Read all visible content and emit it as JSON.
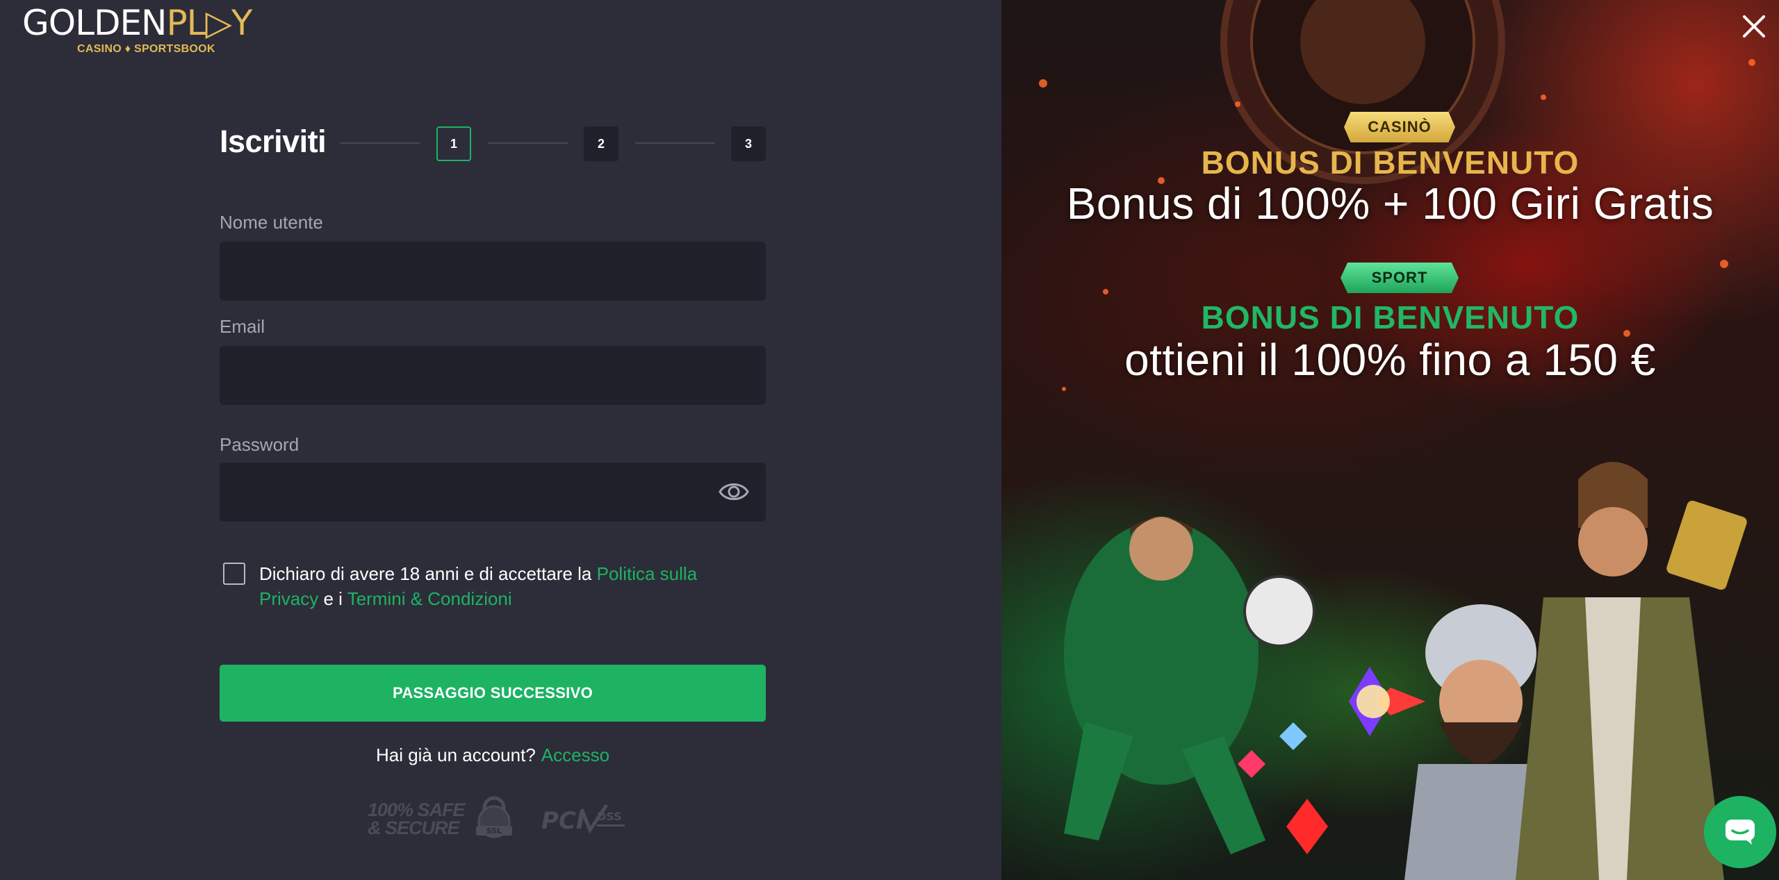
{
  "brand": {
    "logo_part1": "GOLDEN",
    "logo_part2": "PL",
    "logo_part3": "Y",
    "tagline": "CASINO ♦ SPORTSBOOK",
    "accent_color": "#1db363",
    "gold_color": "#e5b957"
  },
  "signup": {
    "title": "Iscriviti",
    "steps": [
      "1",
      "2",
      "3"
    ],
    "active_step": 1,
    "fields": {
      "username_label": "Nome utente",
      "username_value": "",
      "email_label": "Email",
      "email_value": "",
      "password_label": "Password",
      "password_value": ""
    },
    "terms": {
      "checked": false,
      "text_before": "Dichiaro di avere 18 anni e di accettare la ",
      "privacy_link": "Politica sulla Privacy",
      "text_middle": " e i ",
      "terms_link": "Termini & Condizioni"
    },
    "next_button": "PASSAGGIO SUCCESSIVO",
    "login_prompt": "Hai già un account?",
    "login_link": "Accesso"
  },
  "trust_badges": {
    "safe_line1": "100% SAFE",
    "safe_line2": "& SECURE",
    "ssl": "SSL",
    "pci": "PCI",
    "dss": "DSS"
  },
  "promo": {
    "casino_tag": "CASINÒ",
    "casino_kicker": "BONUS DI BENVENUTO",
    "casino_headline": "Bonus di 100% + 100 Giri Gratis",
    "sport_tag": "SPORT",
    "sport_kicker": "BONUS DI BENVENUTO",
    "sport_headline": "ottieni il 100% fino a 150 €"
  },
  "icons": {
    "close": "close-icon",
    "eye": "eye-icon",
    "chat": "chat-icon"
  }
}
